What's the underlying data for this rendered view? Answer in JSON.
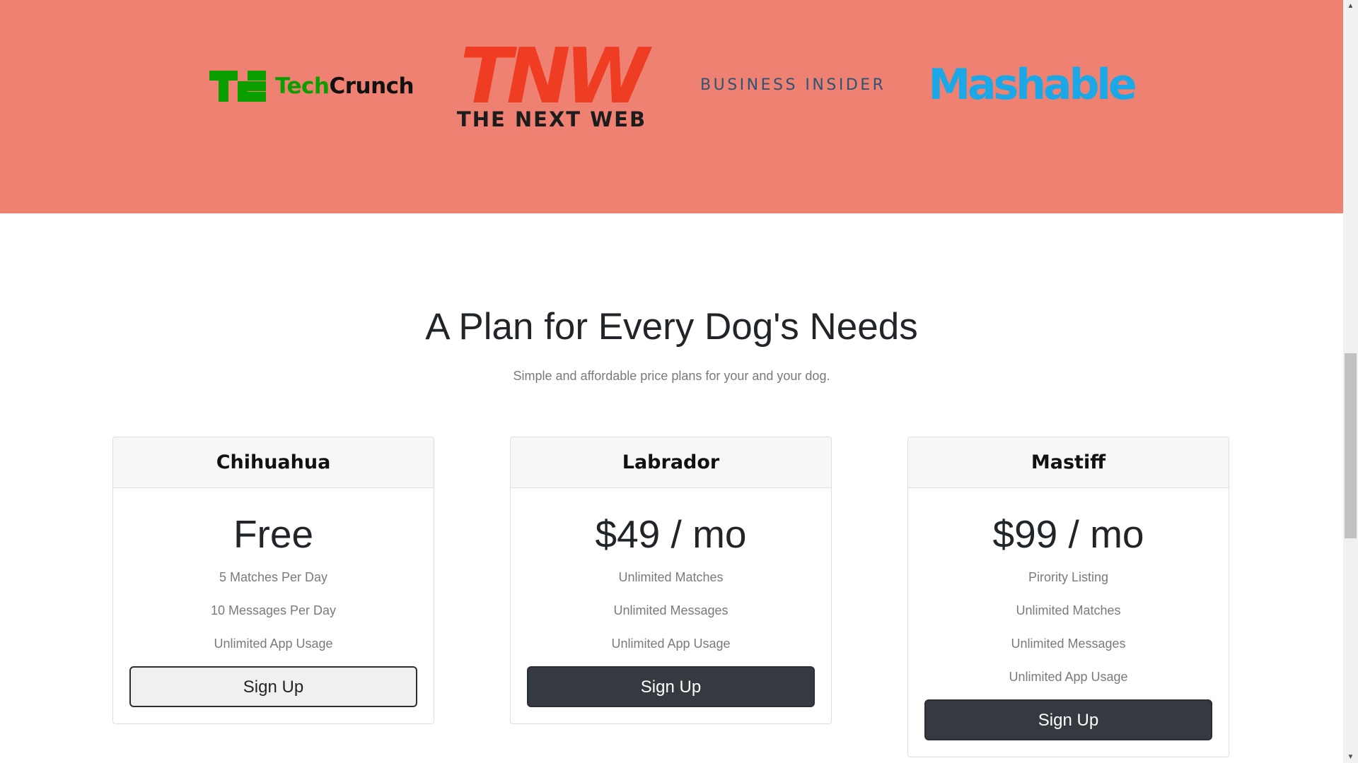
{
  "press": {
    "logos": {
      "techcrunch": {
        "part1": "Tech",
        "part2": "Crunch"
      },
      "tnw": {
        "mark": "TNW",
        "sub": "THE NEXT WEB"
      },
      "business_insider": "BUSINESS INSIDER",
      "mashable": "Mashable"
    },
    "colors": {
      "band": "#ef8172",
      "techcrunch_green": "#0a9e01",
      "tnw_orange": "#ee3d22",
      "bi_blue": "#2e5373",
      "mashable_blue": "#1ca7e6"
    }
  },
  "pricing": {
    "title": "A Plan for Every Dog's Needs",
    "subtitle": "Simple and affordable price plans for your and your dog.",
    "plans": [
      {
        "name": "Chihuahua",
        "price": "Free",
        "features": [
          "5 Matches Per Day",
          "10 Messages Per Day",
          "Unlimited App Usage"
        ],
        "button": "Sign Up"
      },
      {
        "name": "Labrador",
        "price": "$49 / mo",
        "features": [
          "Unlimited Matches",
          "Unlimited Messages",
          "Unlimited App Usage"
        ],
        "button": "Sign Up"
      },
      {
        "name": "Mastiff",
        "price": "$99 / mo",
        "features": [
          "Pirority Listing",
          "Unlimited Matches",
          "Unlimited Messages",
          "Unlimited App Usage"
        ],
        "button": "Sign Up"
      }
    ]
  },
  "scrollbar": {
    "up_icon": "scroll-up-arrow",
    "down_icon": "scroll-down-arrow"
  }
}
